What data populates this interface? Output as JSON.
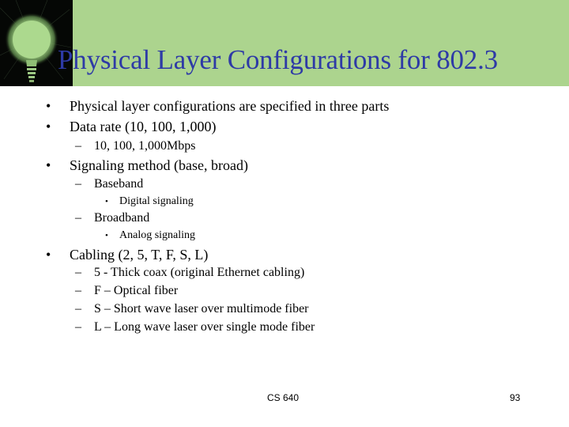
{
  "slide": {
    "title": "Physical Layer Configurations for 802.3",
    "colors": {
      "header_background": "#acd48e",
      "title_text": "#2e3aa6",
      "bulb_panel": "#050705",
      "bulb_glow": "#a8d88a"
    },
    "icon": "lightbulb-icon",
    "bullets": [
      {
        "level": 1,
        "marker": "•",
        "text": "Physical layer configurations are specified in three parts"
      },
      {
        "level": 1,
        "marker": "•",
        "text": "Data rate (10, 100, 1,000)"
      },
      {
        "level": 2,
        "marker": "–",
        "text": "10, 100, 1,000Mbps"
      },
      {
        "level": 1,
        "marker": "•",
        "text": "Signaling method (base, broad)"
      },
      {
        "level": 2,
        "marker": "–",
        "text": "Baseband"
      },
      {
        "level": 3,
        "marker": "•",
        "text": "Digital signaling"
      },
      {
        "level": 2,
        "marker": "–",
        "text": "Broadband"
      },
      {
        "level": 3,
        "marker": "•",
        "text": "Analog signaling"
      },
      {
        "level": 1,
        "marker": "•",
        "text": "Cabling (2, 5, T, F, S, L)"
      },
      {
        "level": 2,
        "marker": "–",
        "text": "5 - Thick coax (original Ethernet cabling)"
      },
      {
        "level": 2,
        "marker": "–",
        "text": "F – Optical fiber"
      },
      {
        "level": 2,
        "marker": "–",
        "text": "S – Short wave laser over multimode fiber"
      },
      {
        "level": 2,
        "marker": "–",
        "text": "L – Long wave laser over single mode fiber"
      }
    ],
    "footer": {
      "course": "CS 640",
      "page_number": "93"
    }
  }
}
